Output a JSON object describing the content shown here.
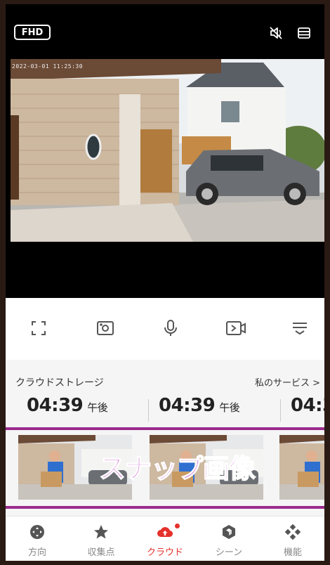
{
  "video": {
    "quality_label": "FHD",
    "timestamp": "2022-03-01 11:25:30",
    "icons": [
      "mute-icon",
      "menu-icon"
    ]
  },
  "controls": {
    "items": [
      "fullscreen-icon",
      "snapshot-icon",
      "microphone-icon",
      "record-icon",
      "more-icon"
    ]
  },
  "cloud": {
    "title": "クラウドストレージ",
    "my_service": "私のサービス >",
    "times": [
      {
        "time": "04:39",
        "ampm": "午後"
      },
      {
        "time": "04:39",
        "ampm": "午後"
      },
      {
        "time": "04:3",
        "ampm": ""
      }
    ],
    "snapshot_label": "スナップ画像"
  },
  "nav": {
    "items": [
      {
        "label": "方向",
        "icon": "direction-icon"
      },
      {
        "label": "収集点",
        "icon": "star-icon"
      },
      {
        "label": "クラウド",
        "icon": "cloud-upload-icon",
        "active": true
      },
      {
        "label": "シーン",
        "icon": "scene-icon"
      },
      {
        "label": "機能",
        "icon": "function-icon"
      }
    ]
  },
  "colors": {
    "accent": "#e5312b",
    "highlight_frame": "#9b2b8e",
    "snapshot_label": "#c23ac0"
  }
}
